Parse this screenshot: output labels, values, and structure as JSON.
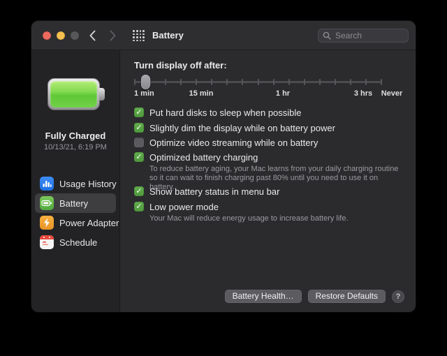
{
  "window": {
    "title": "Battery",
    "search_placeholder": "Search"
  },
  "sidebar": {
    "status_title": "Fully Charged",
    "status_date": "10/13/21, 6:19 PM",
    "items": [
      {
        "label": "Usage History",
        "icon": "bar-chart-icon",
        "selected": false
      },
      {
        "label": "Battery",
        "icon": "battery-icon",
        "selected": true
      },
      {
        "label": "Power Adapter",
        "icon": "lightning-bolt-icon",
        "selected": false
      },
      {
        "label": "Schedule",
        "icon": "calendar-icon",
        "selected": false
      }
    ]
  },
  "content": {
    "display_slider": {
      "label": "Turn display off after:",
      "value": "1 min",
      "tick_labels": [
        "1 min",
        "15 min",
        "1 hr",
        "3 hrs",
        "Never"
      ]
    },
    "checkboxes": [
      {
        "label": "Put hard disks to sleep when possible",
        "checked": true
      },
      {
        "label": "Slightly dim the display while on battery power",
        "checked": true
      },
      {
        "label": "Optimize video streaming while on battery",
        "checked": false
      },
      {
        "label": "Optimized battery charging",
        "checked": true,
        "description": "To reduce battery aging, your Mac learns from your daily charging routine so it can wait to finish charging past 80% until you need to use it on battery."
      },
      {
        "label": "Show battery status in menu bar",
        "checked": true
      },
      {
        "label": "Low power mode",
        "checked": true,
        "description": "Your Mac will reduce energy usage to increase battery life."
      }
    ],
    "footer_buttons": [
      {
        "label": "Battery Health…"
      },
      {
        "label": "Restore Defaults"
      }
    ],
    "help_button_label": "?"
  },
  "colors": {
    "accent_green": "#56a344",
    "traffic_red": "#ed6a5f",
    "traffic_yellow": "#f5bf4f",
    "window_bg": "#2b2b2e",
    "sidebar_bg": "#232326"
  }
}
